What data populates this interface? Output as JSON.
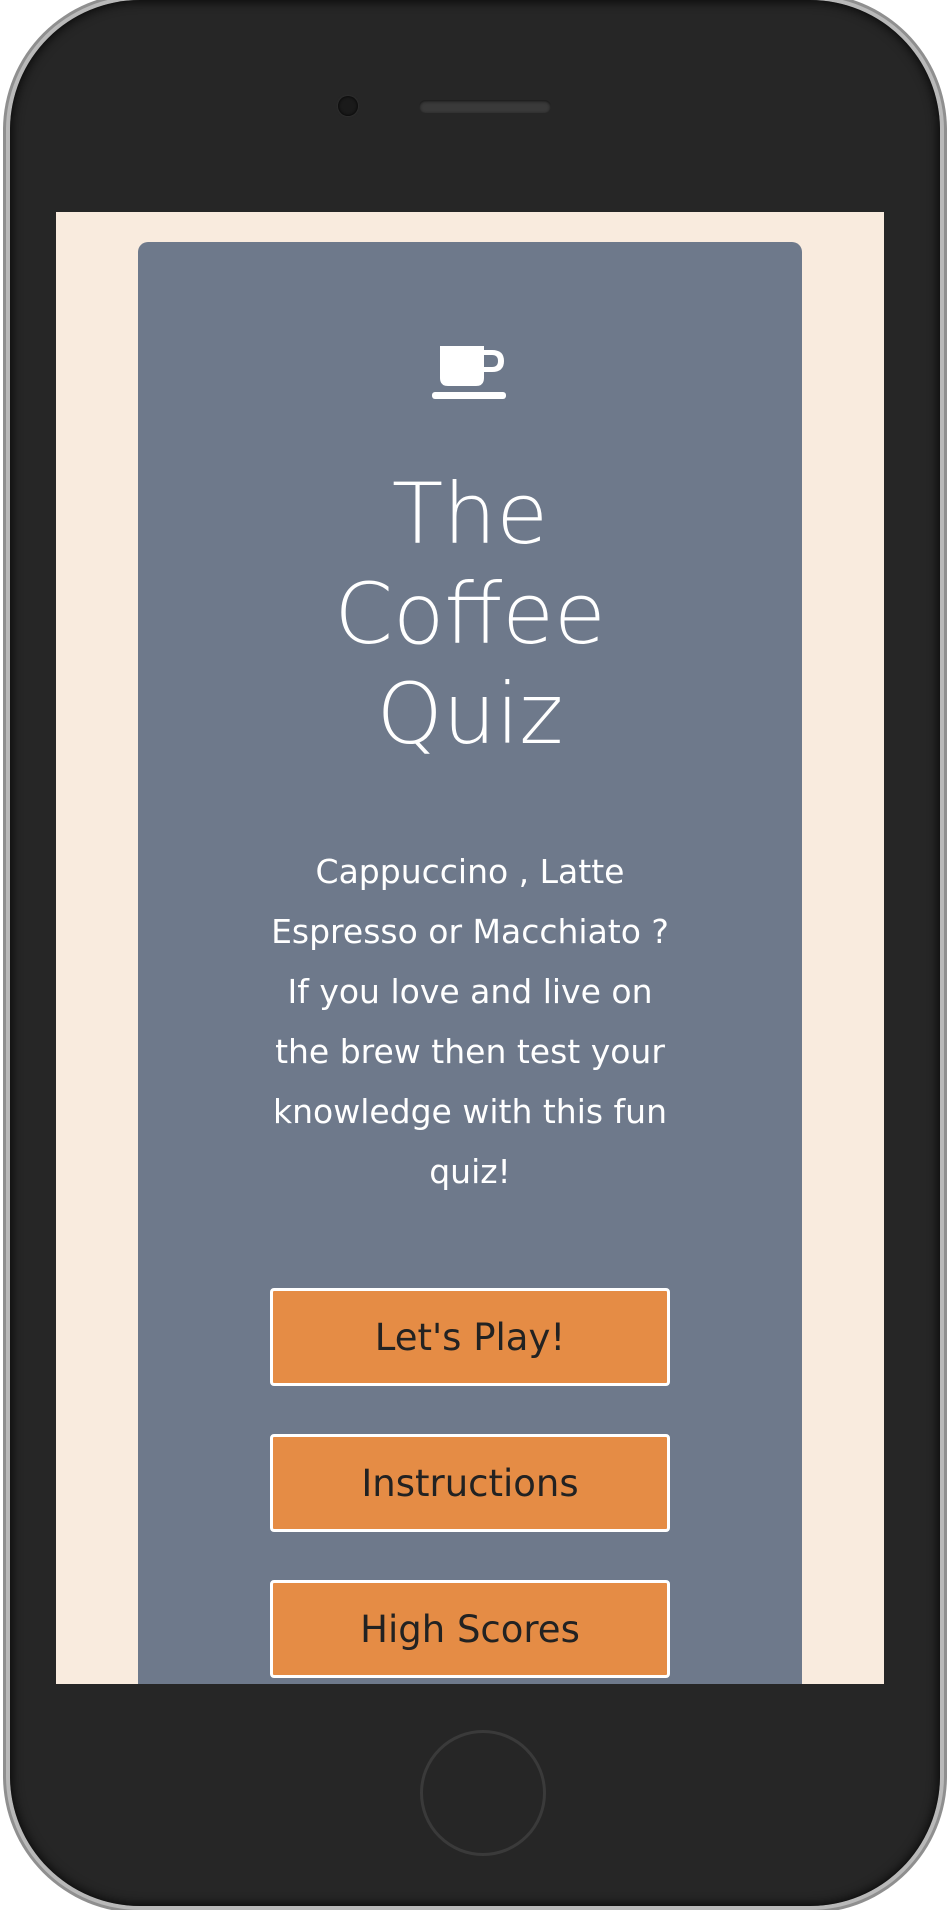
{
  "quiz": {
    "title_lines": [
      "The",
      "Coffee",
      "Quiz"
    ],
    "intro_lines": [
      "Cappuccino , Latte",
      "Espresso or Macchiato ?",
      "If you love and live on",
      "the brew then test your",
      "knowledge with this fun",
      "quiz!"
    ],
    "buttons": {
      "play": "Let's Play!",
      "instructions": "Instructions",
      "high_scores": "High Scores"
    },
    "icon": "coffee-cup-icon"
  },
  "colors": {
    "screen_background": "#f9ebde",
    "card_background": "#6e798b",
    "button_background": "#e58c45",
    "text": "#ffffff",
    "button_text": "#222222"
  }
}
